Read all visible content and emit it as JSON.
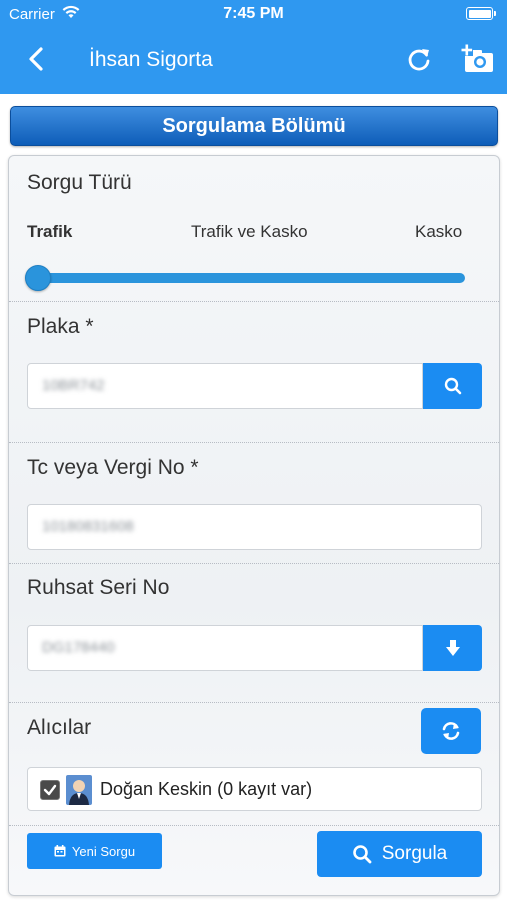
{
  "status_bar": {
    "carrier": "Carrier",
    "time": "7:45 PM"
  },
  "nav": {
    "title": "İhsan Sigorta"
  },
  "section_header": "Sorgulama Bölümü",
  "query_type": {
    "label": "Sorgu Türü",
    "options": [
      "Trafik",
      "Trafik ve Kasko",
      "Kasko"
    ],
    "selected": "Trafik"
  },
  "plate": {
    "label": "Plaka *",
    "value": "10BR742"
  },
  "tc_tax": {
    "label": "Tc veya Vergi No *",
    "value": "10180831608"
  },
  "license_serial": {
    "label": "Ruhsat Seri No",
    "value": "DG178440"
  },
  "recipients": {
    "label": "Alıcılar",
    "items": [
      {
        "name": "Doğan Keskin (0 kayıt var)",
        "checked": true
      }
    ]
  },
  "buttons": {
    "new_query": "Yeni Sorgu",
    "query": "Sorgula"
  },
  "colors": {
    "nav_bg": "#2f98f0",
    "accent": "#1b8cf2",
    "header_bg": "#0e5db8"
  }
}
